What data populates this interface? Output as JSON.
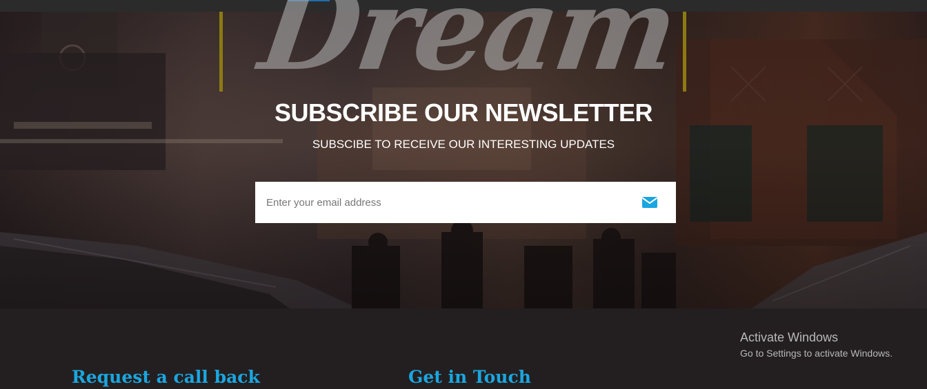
{
  "hero": {
    "script_word": "Dream",
    "title": "SUBSCRIBE OUR NEWSLETTER",
    "subtitle": "SUBSCIBE TO RECEIVE OUR INTERESTING UPDATES",
    "email_placeholder": "Enter your email address",
    "send_icon": "envelope-icon"
  },
  "footer": {
    "request_callback": "Request a call back",
    "get_in_touch": "Get in Touch"
  },
  "watermark": {
    "title": "Activate Windows",
    "subtitle": "Go to Settings to activate Windows."
  },
  "colors": {
    "accent": "#1aa6e0",
    "divider_lines": "#8d7a12",
    "footer_bg": "#231f20"
  }
}
